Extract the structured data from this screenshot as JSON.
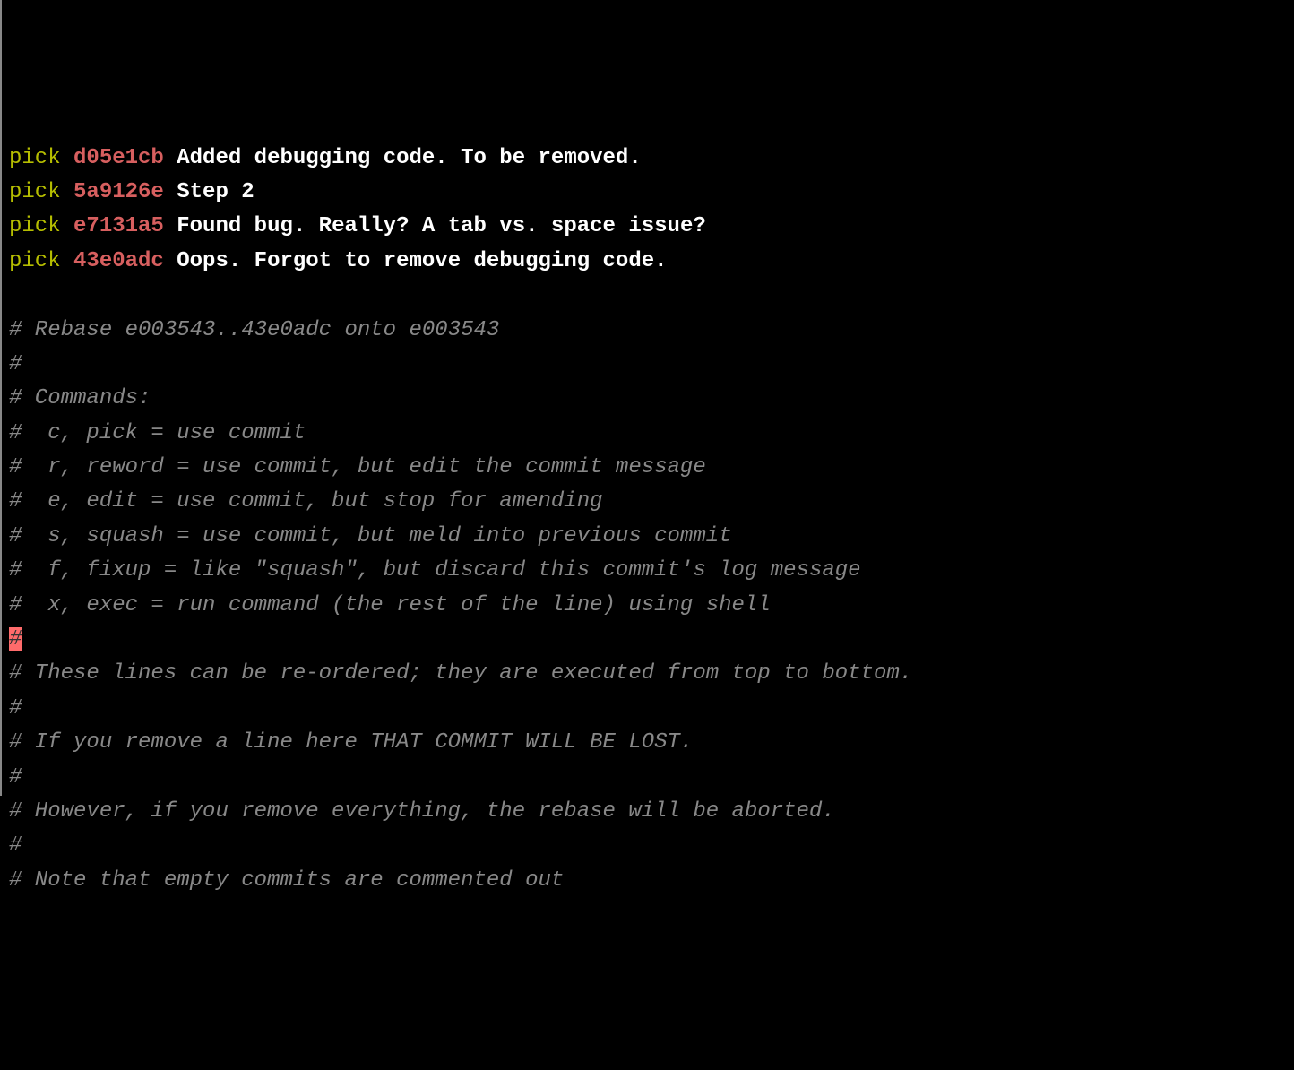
{
  "commits": [
    {
      "action": "pick",
      "hash": "d05e1cb",
      "msg": "Added debugging code. To be removed."
    },
    {
      "action": "pick",
      "hash": "5a9126e",
      "msg": "Step 2"
    },
    {
      "action": "pick",
      "hash": "e7131a5",
      "msg": "Found bug. Really? A tab vs. space issue?"
    },
    {
      "action": "pick",
      "hash": "43e0adc",
      "msg": "Oops. Forgot to remove debugging code."
    }
  ],
  "comments": {
    "rebase_header": "# Rebase e003543..43e0adc onto e003543",
    "hash_only": "#",
    "commands_header": "# Commands:",
    "cmd_pick": "#  c, pick = use commit",
    "cmd_reword": "#  r, reword = use commit, but edit the commit message",
    "cmd_edit": "#  e, edit = use commit, but stop for amending",
    "cmd_squash": "#  s, squash = use commit, but meld into previous commit",
    "cmd_fixup": "#  f, fixup = like \"squash\", but discard this commit's log message",
    "cmd_exec": "#  x, exec = run command (the rest of the line) using shell",
    "cursor_hash": "#",
    "reorder": "# These lines can be re-ordered; they are executed from top to bottom.",
    "remove_warn": "# If you remove a line here THAT COMMIT WILL BE LOST.",
    "abort_note": "# However, if you remove everything, the rebase will be aborted.",
    "empty_note": "# Note that empty commits are commented out"
  }
}
